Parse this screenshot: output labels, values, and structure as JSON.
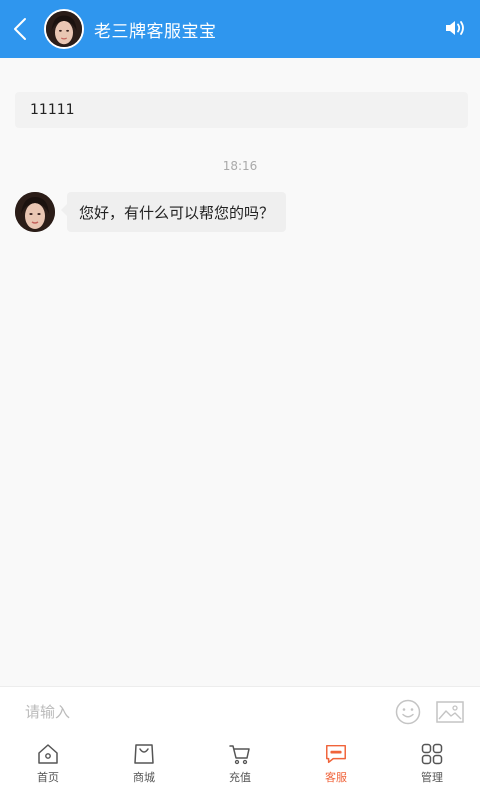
{
  "header": {
    "title": "老三牌客服宝宝",
    "back_icon": "back-arrow-icon",
    "sound_icon": "speaker-icon"
  },
  "chat": {
    "notice_text": "11111",
    "timestamp": "18:16",
    "messages": [
      {
        "sender": "agent",
        "text": "您好，有什么可以帮您的吗？"
      }
    ]
  },
  "input": {
    "placeholder": "请输入",
    "emoji_icon": "smiley-icon",
    "image_icon": "image-icon"
  },
  "nav": {
    "items": [
      {
        "label": "首页",
        "icon": "home-icon"
      },
      {
        "label": "商城",
        "icon": "shopping-bag-icon"
      },
      {
        "label": "充值",
        "icon": "cart-icon"
      },
      {
        "label": "客服",
        "icon": "chat-bubble-icon",
        "active": true
      },
      {
        "label": "管理",
        "icon": "grid-icon"
      }
    ]
  },
  "colors": {
    "header_bg": "#2f96ee",
    "active_nav": "#f0633a",
    "page_bg": "#f9f9f9",
    "bubble_bg": "#efefef"
  }
}
